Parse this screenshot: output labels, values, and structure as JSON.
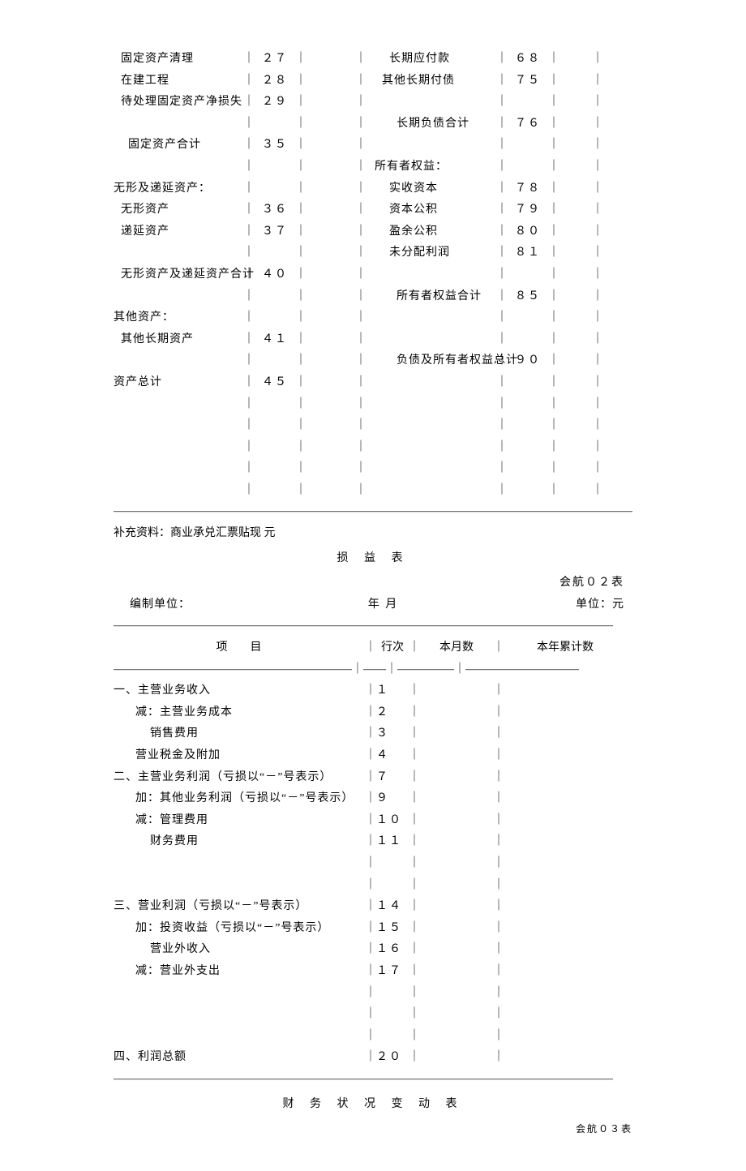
{
  "balance": {
    "rows": [
      {
        "l_label": "  固定资产清理",
        "l_no": "２７",
        "r_label": "    长期应付款",
        "r_no": "６８"
      },
      {
        "l_label": "  在建工程",
        "l_no": "２８",
        "r_label": "  其他长期付债",
        "r_no": "７５"
      },
      {
        "l_label": "  待处理固定资产净损失",
        "l_no": "２９",
        "r_label": "",
        "r_no": ""
      },
      {
        "l_label": "",
        "l_no": "",
        "r_label": "      长期负债合计",
        "r_no": "７６"
      },
      {
        "l_label": "    固定资产合计",
        "l_no": "３５",
        "r_label": "",
        "r_no": ""
      },
      {
        "l_label": "",
        "l_no": "",
        "r_label": "所有者权益：",
        "r_no": ""
      },
      {
        "l_label": "无形及递延资产：",
        "l_no": "",
        "r_label": "    实收资本",
        "r_no": "７８"
      },
      {
        "l_label": "  无形资产",
        "l_no": "３６",
        "r_label": "    资本公积",
        "r_no": "７９"
      },
      {
        "l_label": "  递延资产",
        "l_no": "３７",
        "r_label": "    盈余公积",
        "r_no": "８０"
      },
      {
        "l_label": "",
        "l_no": "",
        "r_label": "    未分配利润",
        "r_no": "８１"
      },
      {
        "l_label": "  无形资产及递延资产合计",
        "l_no": "４０",
        "r_label": "",
        "r_no": ""
      },
      {
        "l_label": "",
        "l_no": "",
        "r_label": "      所有者权益合计",
        "r_no": "８５"
      },
      {
        "l_label": "其他资产：",
        "l_no": "",
        "r_label": "",
        "r_no": ""
      },
      {
        "l_label": "  其他长期资产",
        "l_no": "４１",
        "r_label": "",
        "r_no": ""
      },
      {
        "l_label": "",
        "l_no": "",
        "r_label": "      负债及所有者权益总计",
        "r_no": "９０"
      },
      {
        "l_label": "资产总计",
        "l_no": "４５",
        "r_label": "",
        "r_no": ""
      },
      {
        "l_label": "",
        "l_no": "",
        "r_label": "",
        "r_no": ""
      },
      {
        "l_label": "",
        "l_no": "",
        "r_label": "",
        "r_no": ""
      },
      {
        "l_label": "",
        "l_no": "",
        "r_label": "",
        "r_no": ""
      },
      {
        "l_label": "",
        "l_no": "",
        "r_label": "",
        "r_no": ""
      },
      {
        "l_label": "",
        "l_no": "",
        "r_label": "",
        "r_no": ""
      }
    ]
  },
  "supplementary": "  补充资料：商业承兑汇票贴现              元",
  "income": {
    "title": "损  益  表",
    "form_no": "会航０２表",
    "unit_label": "编制单位：",
    "date_label": "年    月",
    "currency": "单位：元",
    "header": {
      "item": "项      目",
      "line": "行次",
      "month": "本月数",
      "year": "本年累计数"
    },
    "rows": [
      {
        "label": "一、主营业务收入",
        "no": "１"
      },
      {
        "label": "      减：主营业务成本",
        "no": "２"
      },
      {
        "label": "          销售费用",
        "no": "３"
      },
      {
        "label": "      营业税金及附加",
        "no": "４"
      },
      {
        "label": "二、主营业务利润（亏损以“－”号表示）",
        "no": "７"
      },
      {
        "label": "      加：其他业务利润（亏损以“－”号表示）",
        "no": "９"
      },
      {
        "label": "      减：管理费用",
        "no": "１０"
      },
      {
        "label": "          财务费用",
        "no": "１１"
      },
      {
        "label": "",
        "no": ""
      },
      {
        "label": "",
        "no": ""
      },
      {
        "label": "三、营业利润（亏损以“－”号表示）",
        "no": "１４"
      },
      {
        "label": "      加：投资收益（亏损以“－”号表示）",
        "no": "１５"
      },
      {
        "label": "          营业外收入",
        "no": "１６"
      },
      {
        "label": "      减：营业外支出",
        "no": "１７"
      },
      {
        "label": "",
        "no": ""
      },
      {
        "label": "",
        "no": ""
      },
      {
        "label": "",
        "no": ""
      },
      {
        "label": "四、利润总额",
        "no": "２０"
      }
    ]
  },
  "cashflow": {
    "title": "财  务  状  况  变  动  表",
    "form_no": "会航０３表"
  }
}
